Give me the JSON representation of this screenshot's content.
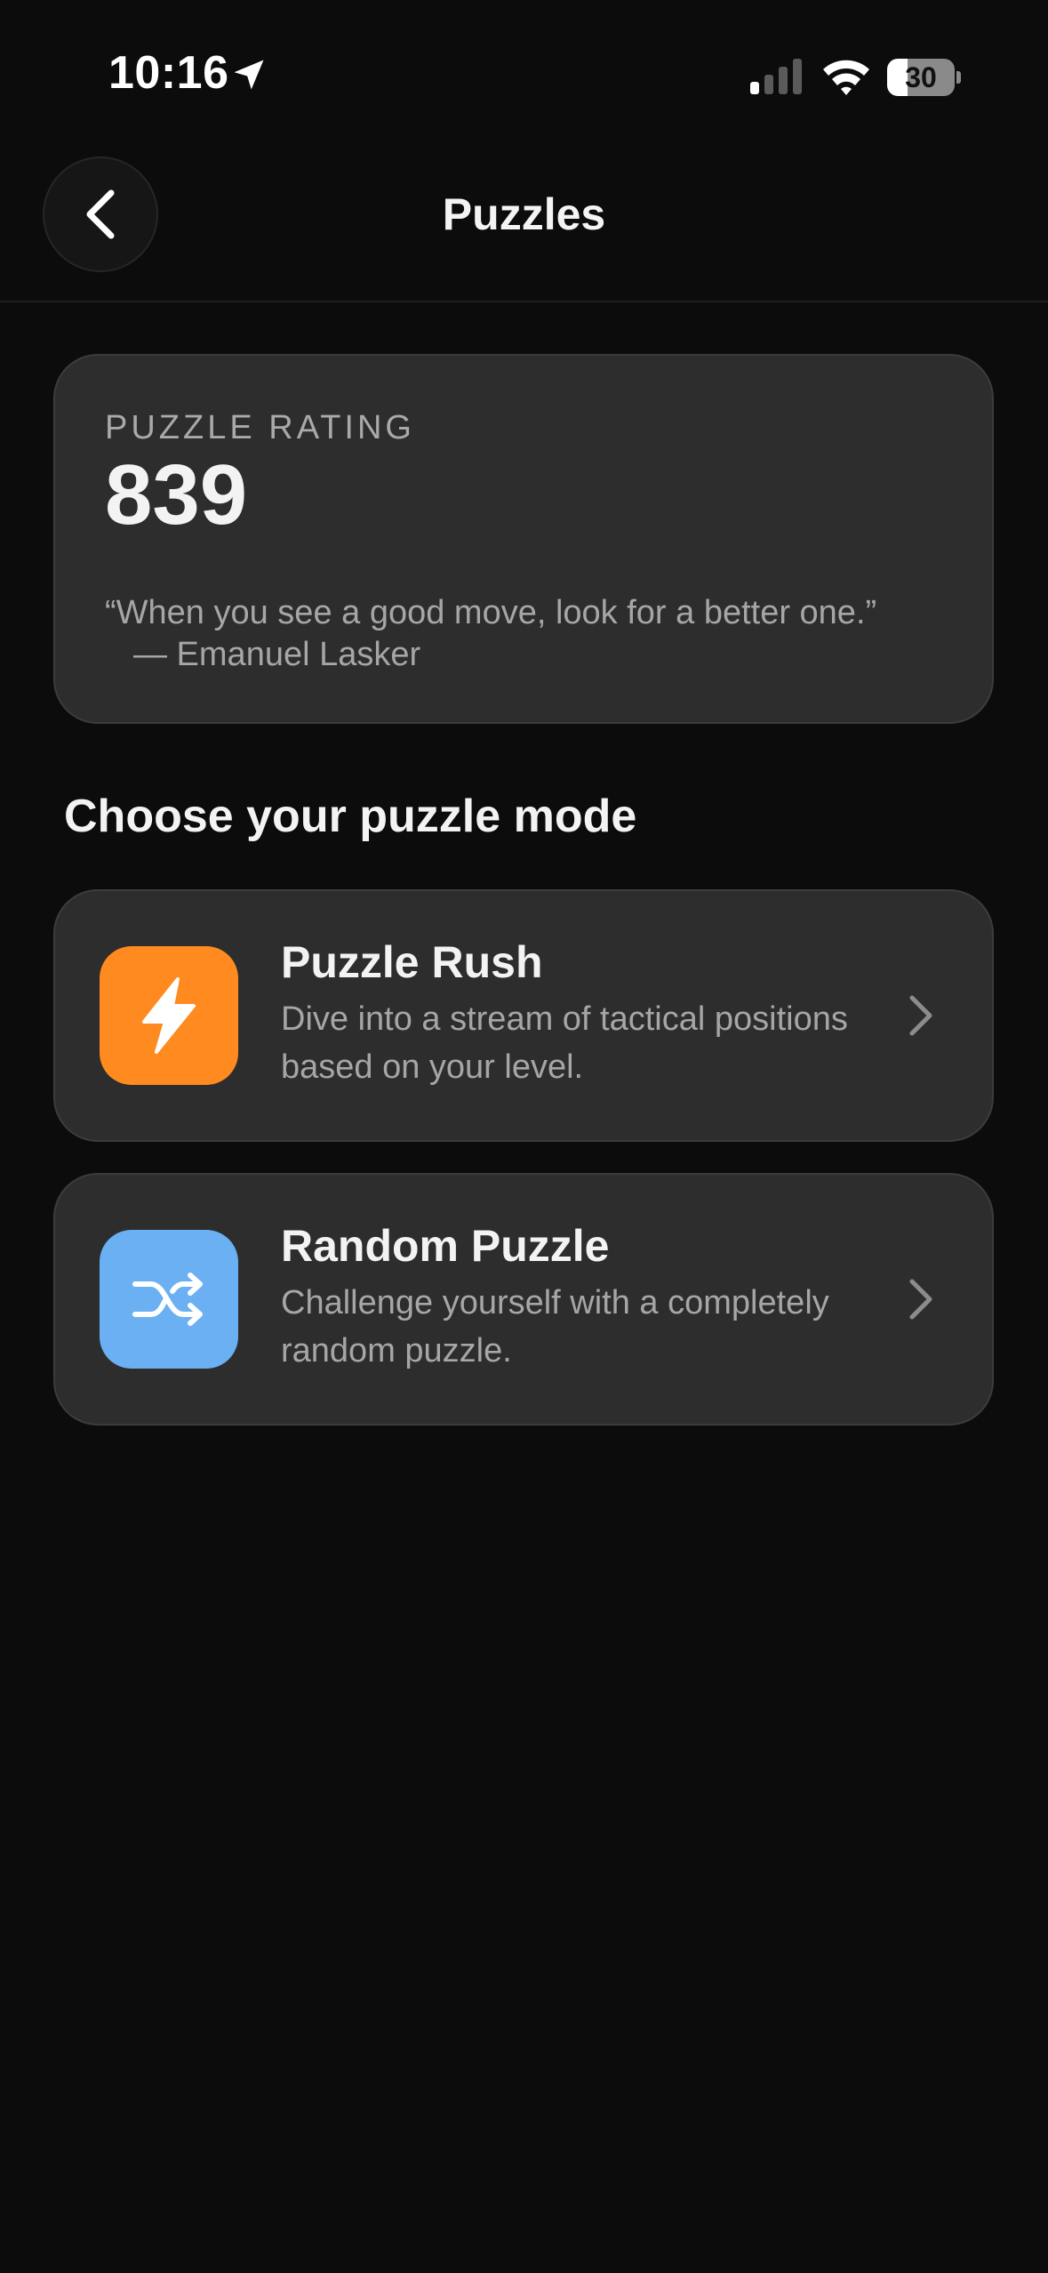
{
  "status_bar": {
    "time": "10:16",
    "battery_level": "30",
    "battery_fraction": 0.3
  },
  "nav": {
    "title": "Puzzles",
    "back_icon": "chevron-left-icon"
  },
  "rating": {
    "label": "PUZZLE RATING",
    "value": "839",
    "quote": "“When you see a good move, look for a better one.”",
    "author": "— Emanuel Lasker"
  },
  "modes_section": {
    "title": "Choose your puzzle mode",
    "items": [
      {
        "title": "Puzzle Rush",
        "description": "Dive into a stream of tactical positions based on your level.",
        "icon": "lightning-icon",
        "color": "#ff8a1f"
      },
      {
        "title": "Random Puzzle",
        "description": "Challenge yourself with a completely random puzzle.",
        "icon": "shuffle-icon",
        "color": "#6ab0f2"
      }
    ]
  },
  "colors": {
    "background": "#0c0c0c",
    "card": "#2d2d2d",
    "secondary_text": "#a6a6a6"
  }
}
